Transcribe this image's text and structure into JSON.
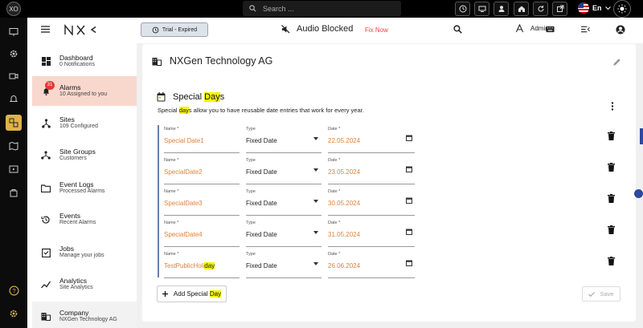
{
  "topbar": {
    "brand_initials": "XO",
    "search_placeholder": "Search ...",
    "language": "En",
    "colors": {
      "background": "#000000",
      "accent": "#e0b24a"
    }
  },
  "header": {
    "trial_label": "Trial - Expired",
    "audio_label": "Audio Blocked",
    "fix_now_label": "Fix Now",
    "admin_label": "Admin"
  },
  "nav": {
    "items": [
      {
        "label": "Dashboard",
        "sub": "0 Notifications",
        "icon": "dashboard-icon"
      },
      {
        "label": "Alarms",
        "sub": "10 Assigned to you",
        "icon": "bell-icon",
        "badge": "31"
      },
      {
        "label": "Sites",
        "sub": "109 Configured",
        "icon": "sites-icon"
      },
      {
        "label": "Site Groups",
        "sub": "Customers",
        "icon": "site-groups-icon"
      },
      {
        "label": "Event Logs",
        "sub": "Processed Alarms",
        "icon": "folder-icon"
      },
      {
        "label": "Events",
        "sub": "Recent Alarms",
        "icon": "history-icon"
      },
      {
        "label": "Jobs",
        "sub": "Manage your jobs",
        "icon": "jobs-icon"
      },
      {
        "label": "Analytics",
        "sub": "Site Analytics",
        "icon": "analytics-icon"
      },
      {
        "label": "Company",
        "sub": "NXGen Technology AG",
        "icon": "company-icon"
      }
    ]
  },
  "main": {
    "company_title": "NXGen Technology AG",
    "special_days": {
      "title_prefix": "Special ",
      "title_highlight": "Day",
      "title_suffix": "s",
      "desc_prefix": "Special ",
      "desc_highlight": "day",
      "desc_suffix": "s allow you to have reusable date entries that work for every year.",
      "name_label": "Name *",
      "type_label": "Type",
      "date_label": "Date *",
      "rows": [
        {
          "name": "Special Date1",
          "type": "Fixed Date",
          "date": "22.05.2024"
        },
        {
          "name": "SpecialDate2",
          "type": "Fixed Date",
          "date": "23.05.2024"
        },
        {
          "name": "SpecialDate3",
          "type": "Fixed Date",
          "date": "30.05.2024"
        },
        {
          "name": "SpecialDate4",
          "type": "Fixed Date",
          "date": "31.05.2024"
        },
        {
          "name_prefix": "TestPublicHoli",
          "name_highlight": "day",
          "type": "Fixed Date",
          "date": "26.06.2024"
        }
      ],
      "add_prefix": "Add Special ",
      "add_highlight": "Day",
      "save_label": "Save"
    }
  }
}
